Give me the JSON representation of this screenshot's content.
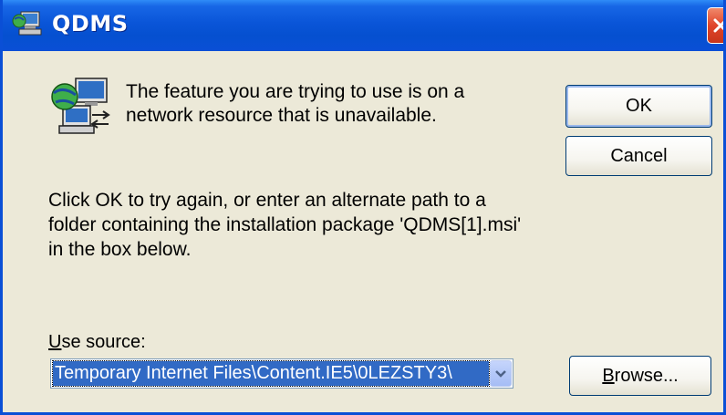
{
  "window": {
    "title": "QDMS",
    "app_icon": "installer-computer-icon",
    "close_icon": "close-icon"
  },
  "message": {
    "icon": "network-computer-icon",
    "line1": "The feature you are trying to use is on a network resource that is unavailable.",
    "line2": "Click OK to try again, or enter an alternate path to a folder containing the installation package 'QDMS[1].msi' in the box below."
  },
  "buttons": {
    "ok": "OK",
    "cancel": "Cancel",
    "browse_prefix": "B",
    "browse_rest": "rowse..."
  },
  "source": {
    "label_prefix": "U",
    "label_rest": "se source:",
    "value": "Temporary Internet Files\\Content.IE5\\0LEZSTY3\\",
    "dropdown_icon": "chevron-down-icon"
  },
  "colors": {
    "titlebar": "#0a55d8",
    "dialog_bg": "#ece9d8",
    "selection": "#316ac5",
    "close_button": "#e0442a"
  }
}
